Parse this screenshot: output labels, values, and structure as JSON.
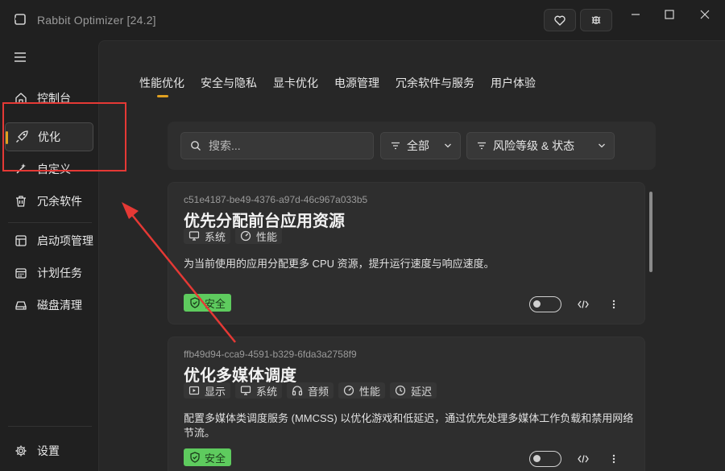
{
  "window": {
    "title": "Rabbit Optimizer [24.2]",
    "buttons": {
      "heart": "heart-icon",
      "code": "code-icon"
    }
  },
  "sidebar": {
    "items": [
      {
        "label": "控制台",
        "icon": "home-icon"
      },
      {
        "label": "优化",
        "icon": "rocket-icon",
        "active": true
      },
      {
        "label": "自定义",
        "icon": "wand-icon"
      },
      {
        "label": "冗余软件",
        "icon": "trash-icon"
      },
      {
        "label": "启动项管理",
        "icon": "startup-icon"
      },
      {
        "label": "计划任务",
        "icon": "calendar-icon"
      },
      {
        "label": "磁盘清理",
        "icon": "disk-icon"
      }
    ],
    "settings": {
      "label": "设置",
      "icon": "gear-icon"
    }
  },
  "tabs": [
    "性能优化",
    "安全与隐私",
    "显卡优化",
    "电源管理",
    "冗余软件与服务",
    "用户体验"
  ],
  "filters": {
    "search_placeholder": "搜索...",
    "category": "全部",
    "risk_status": "风险等级 & 状态"
  },
  "cards": [
    {
      "id": "c51e4187-be49-4376-a97d-46c967a033b5",
      "title": "优先分配前台应用资源",
      "tags": [
        {
          "label": "系统",
          "icon": "monitor-icon"
        },
        {
          "label": "性能",
          "icon": "gauge-icon"
        }
      ],
      "description": "为当前使用的应用分配更多 CPU 资源，提升运行速度与响应速度。",
      "badge": "安全",
      "enabled": false
    },
    {
      "id": "ffb49d94-cca9-4591-b329-6fda3a2758f9",
      "title": "优化多媒体调度",
      "tags": [
        {
          "label": "显示",
          "icon": "display-icon"
        },
        {
          "label": "系统",
          "icon": "monitor-icon"
        },
        {
          "label": "音频",
          "icon": "headphones-icon"
        },
        {
          "label": "性能",
          "icon": "gauge-icon"
        },
        {
          "label": "延迟",
          "icon": "clock-icon"
        }
      ],
      "description": "配置多媒体类调度服务 (MMCSS) 以优化游戏和低延迟，通过优先处理多媒体工作负载和禁用网络节流。",
      "badge": "安全",
      "enabled": false
    }
  ],
  "colors": {
    "accent": "#e0a020",
    "safe": "#5ecb5e",
    "annotation": "#e53935"
  }
}
